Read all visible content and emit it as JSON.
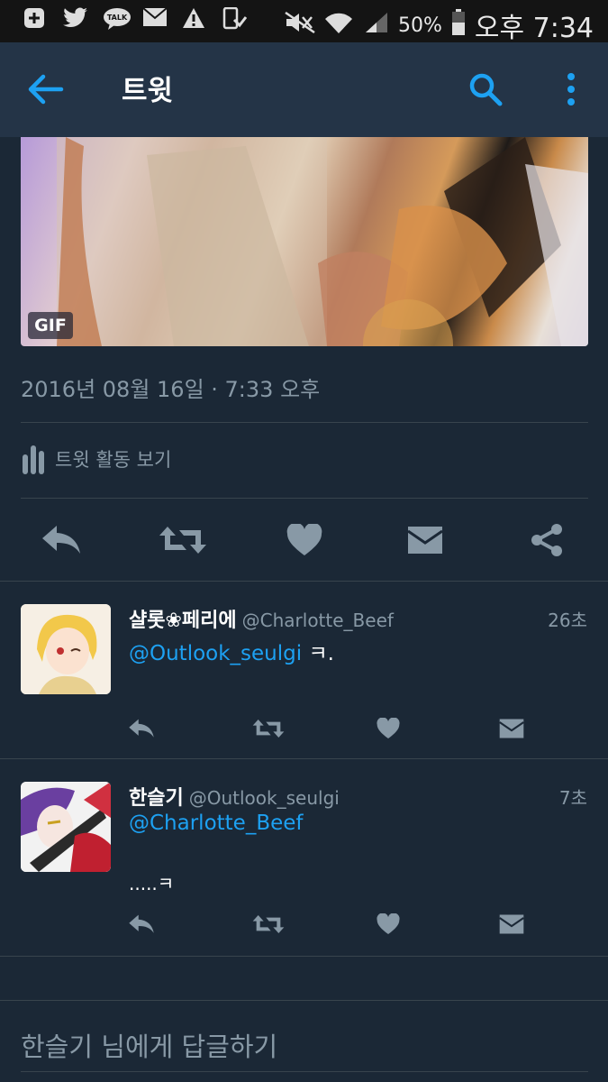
{
  "status_bar": {
    "battery_pct": "50%",
    "time": "오후 7:34",
    "kakao_label": "TALK"
  },
  "app_bar": {
    "title": "트윗"
  },
  "tweet": {
    "gif_badge": "GIF",
    "timestamp": "2016년 08월 16일 · 7:33 오후",
    "activity_label": "트윗 활동 보기"
  },
  "replies": [
    {
      "name": "샬롯❀페리에",
      "handle": "@Charlotte_Beef",
      "time": "26초",
      "mention": "@Outlook_seulgi",
      "text": " ㅋ."
    },
    {
      "name": "한슬기",
      "handle": "@Outlook_seulgi",
      "time": "7초",
      "mention": "@Charlotte_Beef",
      "text": ".....ㅋ"
    }
  ],
  "reply_placeholder": "한슬기 님에게 답글하기",
  "colors": {
    "background": "#1b2836",
    "app_bar": "#243447",
    "accent": "#1da1f2",
    "muted": "#8899a6"
  }
}
